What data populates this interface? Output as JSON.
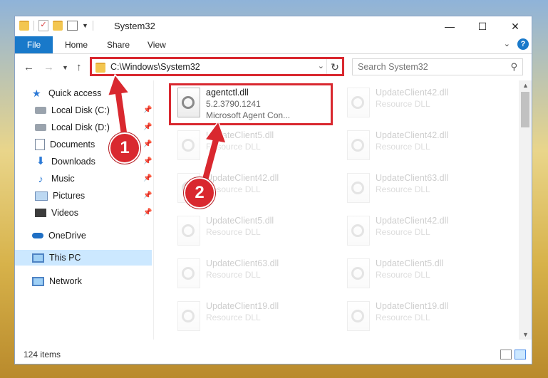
{
  "window": {
    "title": "System32"
  },
  "ribbon": {
    "tabs": [
      "File",
      "Home",
      "Share",
      "View"
    ]
  },
  "address": {
    "path": "C:\\Windows\\System32"
  },
  "search": {
    "placeholder": "Search System32"
  },
  "nav": {
    "items": [
      {
        "label": "Quick access",
        "icon": "star-icon",
        "pinned": false
      },
      {
        "label": "Local Disk (C:)",
        "icon": "drive-icon",
        "pinned": true
      },
      {
        "label": "Local Disk (D:)",
        "icon": "drive-icon",
        "pinned": true
      },
      {
        "label": "Documents",
        "icon": "documents-icon",
        "pinned": true
      },
      {
        "label": "Downloads",
        "icon": "download-icon",
        "pinned": true
      },
      {
        "label": "Music",
        "icon": "music-icon",
        "pinned": true
      },
      {
        "label": "Pictures",
        "icon": "pictures-icon",
        "pinned": true
      },
      {
        "label": "Videos",
        "icon": "videos-icon",
        "pinned": true
      },
      {
        "label": "OneDrive",
        "icon": "cloud-icon",
        "pinned": false
      },
      {
        "label": "This PC",
        "icon": "computer-icon",
        "pinned": false,
        "selected": true
      },
      {
        "label": "Network",
        "icon": "network-icon",
        "pinned": false
      }
    ]
  },
  "files": [
    {
      "name": "agentctl.dll",
      "line2": "5.2.3790.1241",
      "line3": "Microsoft Agent Con...",
      "highlighted": true
    },
    {
      "name": "UpdateClient42.dll",
      "line2": "Resource DLL"
    },
    {
      "name": "UpdateClient5.dll",
      "line2": "Resource DLL"
    },
    {
      "name": "UpdateClient42.dll",
      "line2": "Resource DLL"
    },
    {
      "name": "UpdateClient42.dll",
      "line2": "Resource DLL"
    },
    {
      "name": "UpdateClient63.dll",
      "line2": "Resource DLL"
    },
    {
      "name": "UpdateClient5.dll",
      "line2": "Resource DLL"
    },
    {
      "name": "UpdateClient42.dll",
      "line2": "Resource DLL"
    },
    {
      "name": "UpdateClient63.dll",
      "line2": "Resource DLL"
    },
    {
      "name": "UpdateClient5.dll",
      "line2": "Resource DLL"
    },
    {
      "name": "UpdateClient19.dll",
      "line2": "Resource DLL"
    },
    {
      "name": "UpdateClient19.dll",
      "line2": "Resource DLL"
    }
  ],
  "status": {
    "items_count": "124 items"
  },
  "annotations": [
    {
      "number": "1",
      "color": "#d9282f"
    },
    {
      "number": "2",
      "color": "#d9282f"
    }
  ],
  "colors": {
    "accent": "#1979ca",
    "highlight": "#d9282f",
    "selection": "#cce8ff"
  }
}
